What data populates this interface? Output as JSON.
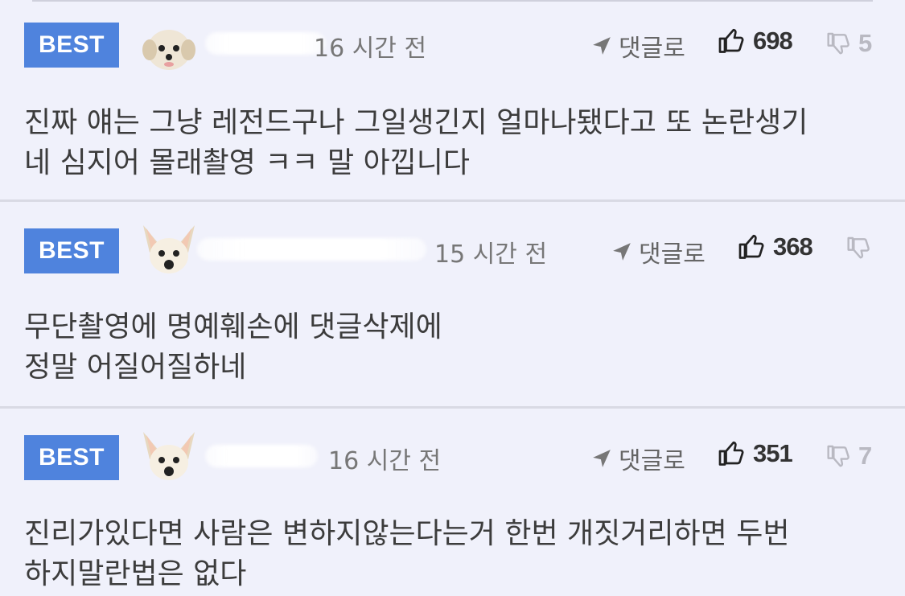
{
  "comments": [
    {
      "badge": "BEST",
      "avatar": "maltese-dog-avatar",
      "time": "16 시간 전",
      "reply_label": "댓글로",
      "likes": "698",
      "dislikes": "5",
      "text": "진짜 얘는 그냥 레전드구나 그일생긴지 얼마나됐다고 또 논란생기\n네 심지어 몰래촬영 ㅋㅋ 말 아낍니다"
    },
    {
      "badge": "BEST",
      "avatar": "chihuahua-avatar",
      "time": "15 시간 전",
      "reply_label": "댓글로",
      "likes": "368",
      "dislikes": "",
      "text": "무단촬영에 명예훼손에 댓글삭제에\n정말 어질어질하네"
    },
    {
      "badge": "BEST",
      "avatar": "chihuahua-avatar",
      "time": "16 시간 전",
      "reply_label": "댓글로",
      "likes": "351",
      "dislikes": "7",
      "text": "진리가있다면 사람은 변하지않는다는거 한번 개짓거리하면 두번\n하지말란법은 없다"
    }
  ],
  "colors": {
    "badge": "#4f83dd",
    "background": "#f0f1fb",
    "separator": "#d9dae4"
  }
}
